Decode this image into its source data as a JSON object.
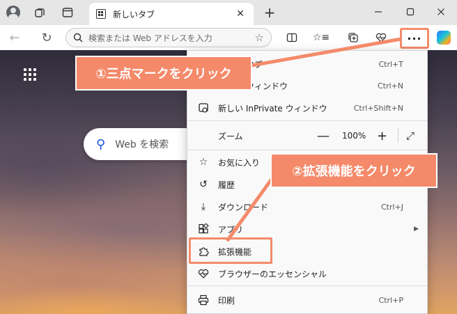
{
  "tab": {
    "title": "新しいタブ"
  },
  "address_bar": {
    "placeholder": "検索または Web アドレスを入力"
  },
  "new_tab_page": {
    "search_placeholder": "Web を検索"
  },
  "icons": {
    "profile": "profile-icon",
    "workspaces": "workspaces-icon",
    "tab_actions": "tab-actions-icon",
    "close": "close-icon",
    "new_tab": "plus-icon",
    "back": "arrow-left-icon",
    "refresh": "refresh-icon",
    "search": "search-icon",
    "favorite": "star-icon",
    "split_screen": "split-screen-icon",
    "favorites": "favorites-icon",
    "collections": "collections-icon",
    "browser_essentials": "heart-pulse-icon",
    "more": "more-icon",
    "copilot": "copilot-icon"
  },
  "menu": {
    "items": [
      {
        "label": "タブ",
        "shortcut": "Ctrl+T",
        "icon": "new-tab-icon"
      },
      {
        "label": "ウィンドウ",
        "shortcut": "Ctrl+N",
        "icon": "new-window-icon"
      },
      {
        "label": "新しい InPrivate ウィンドウ",
        "shortcut": "Ctrl+Shift+N",
        "icon": "inprivate-icon"
      },
      {
        "label": "ズーム",
        "icon": ""
      },
      {
        "label": "お気に入り",
        "shortcut": "",
        "icon": "favorites-star-icon"
      },
      {
        "label": "履歴",
        "shortcut": "",
        "icon": "history-icon"
      },
      {
        "label": "ダウンロード",
        "shortcut": "Ctrl+J",
        "icon": "download-icon"
      },
      {
        "label": "アプリ",
        "shortcut": "",
        "icon": "apps-icon"
      },
      {
        "label": "拡張機能",
        "shortcut": "",
        "icon": "extensions-icon"
      },
      {
        "label": "ブラウザーのエッセンシャル",
        "shortcut": "",
        "icon": "browser-essentials-icon"
      },
      {
        "label": "印刷",
        "shortcut": "Ctrl+P",
        "icon": "print-icon"
      }
    ],
    "zoom": {
      "minus": "—",
      "value": "100%",
      "plus": "+"
    }
  },
  "annotations": {
    "step1": "①三点マークをクリック",
    "step2": "②拡張機能をクリック",
    "accent_color": "#f48a6a"
  }
}
